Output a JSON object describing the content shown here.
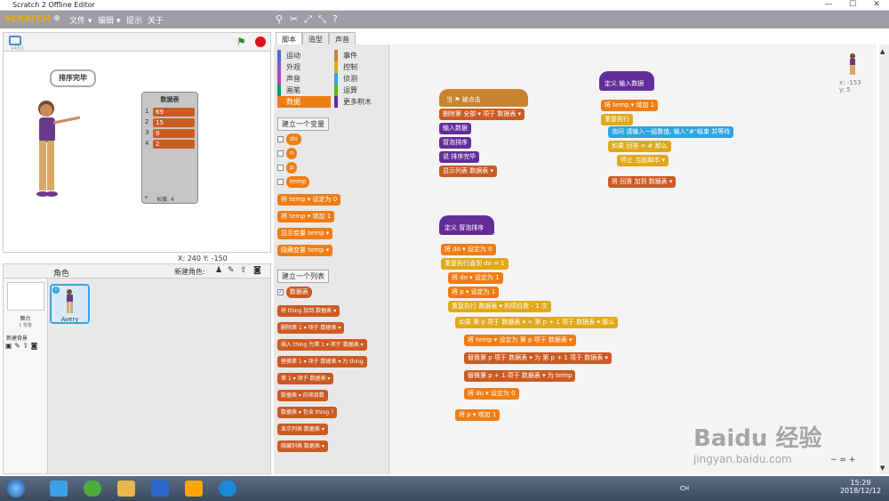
{
  "window": {
    "title": "Scratch 2 Offline Editor",
    "controls": [
      "—",
      "☐",
      "✕"
    ]
  },
  "menubar": {
    "logo": "SCRATCH",
    "items": [
      "文件 ▾",
      "编辑 ▾",
      "提示",
      "关于"
    ]
  },
  "stage": {
    "version": "v451",
    "speech": "排序完毕",
    "list_monitor": {
      "title": "数据表",
      "rows": [
        [
          "1",
          "69"
        ],
        [
          "2",
          "15"
        ],
        [
          "3",
          "9"
        ],
        [
          "4",
          "2"
        ]
      ],
      "length_label": "长度: 4"
    },
    "coords": "X: 240  Y: -150"
  },
  "sprites": {
    "header": "角色",
    "new_sprite_label": "新建角色:",
    "stage_label": "舞台",
    "stage_sub": "1 背景",
    "new_backdrop": "新建背景",
    "sprite_name": "Avery"
  },
  "tabs": [
    "脚本",
    "造型",
    "声音"
  ],
  "categories": {
    "left": [
      "运动",
      "外观",
      "声音",
      "画笔",
      "数据"
    ],
    "right": [
      "事件",
      "控制",
      "侦测",
      "运算",
      "更多积木"
    ],
    "colors_left": [
      "#4a6cd4",
      "#8a55d7",
      "#bb42c3",
      "#0e9a6c",
      "#ee7d16"
    ],
    "colors_right": [
      "#c88330",
      "#e1a91a",
      "#2ca5e2",
      "#5cb712",
      "#632d99"
    ]
  },
  "palette": {
    "make_var": "建立一个变量",
    "vars": [
      "do",
      "n",
      "p",
      "temp"
    ],
    "var_blocks": [
      "将 temp ▾ 设定为 0",
      "将 temp ▾ 增加 1",
      "显示变量 temp ▾",
      "隐藏变量 temp ▾"
    ],
    "make_list": "建立一个列表",
    "list_name": "数据表",
    "list_blocks": [
      "将 thing 加到 数据表 ▾",
      "删除第 1 ▾ 项于 数据表 ▾",
      "插入 thing 为第 1 ▾ 项于 数据表 ▾",
      "替换第 1 ▾ 项于 数据表 ▾ 为 thing",
      "第 1 ▾ 项于 数据表 ▾",
      "数据表 ▾ 的项目数",
      "数据表 ▾ 包含 thing ?",
      "显示列表 数据表 ▾",
      "隐藏列表 数据表 ▾"
    ]
  },
  "scripts": {
    "s1": [
      "当 ⚑ 被点击",
      "删除第 全部 ▾ 项于 数据表 ▾",
      "输入数据",
      "冒泡排序",
      "说 排序完毕",
      "显示列表 数据表 ▾"
    ],
    "s2": [
      "定义 输入数据",
      "将 temp ▾ 增加 1",
      "重复执行",
      "询问 请输入一组数值, 输入\"#\"结束 并等待",
      "如果 回答 = # 那么",
      "停止 当前脚本 ▾",
      "将 回答 加到 数据表 ▾"
    ],
    "s3": [
      "定义 冒泡排序",
      "将 do ▾ 设定为 0",
      "重复执行直到 do = 1",
      "将 do ▾ 设定为 1",
      "将 p ▾ 设定为 1",
      "重复执行 数据表 ▾ 的项目数 - 1 次",
      "如果 第 p 项于 数据表 ▾ < 第 p + 1 项于 数据表 ▾ 那么",
      "将 temp ▾ 设定为 第 p 项于 数据表 ▾",
      "替换第 p 项于 数据表 ▾ 为 第 p + 1 项于 数据表 ▾",
      "替换第 p + 1 项于 数据表 ▾ 为 temp",
      "将 do ▾ 设定为 0",
      "将 p ▾ 增加 1"
    ]
  },
  "sprite_info": {
    "x": "x: -153",
    "y": "y: 5"
  },
  "watermark": {
    "brand": "Baidu 经验",
    "url": "jingyan.baidu.com"
  },
  "zoom": [
    "−",
    "=",
    "+"
  ],
  "taskbar": {
    "clock_time": "15:29",
    "clock_date": "2018/12/12",
    "tray_lang": "CH"
  }
}
